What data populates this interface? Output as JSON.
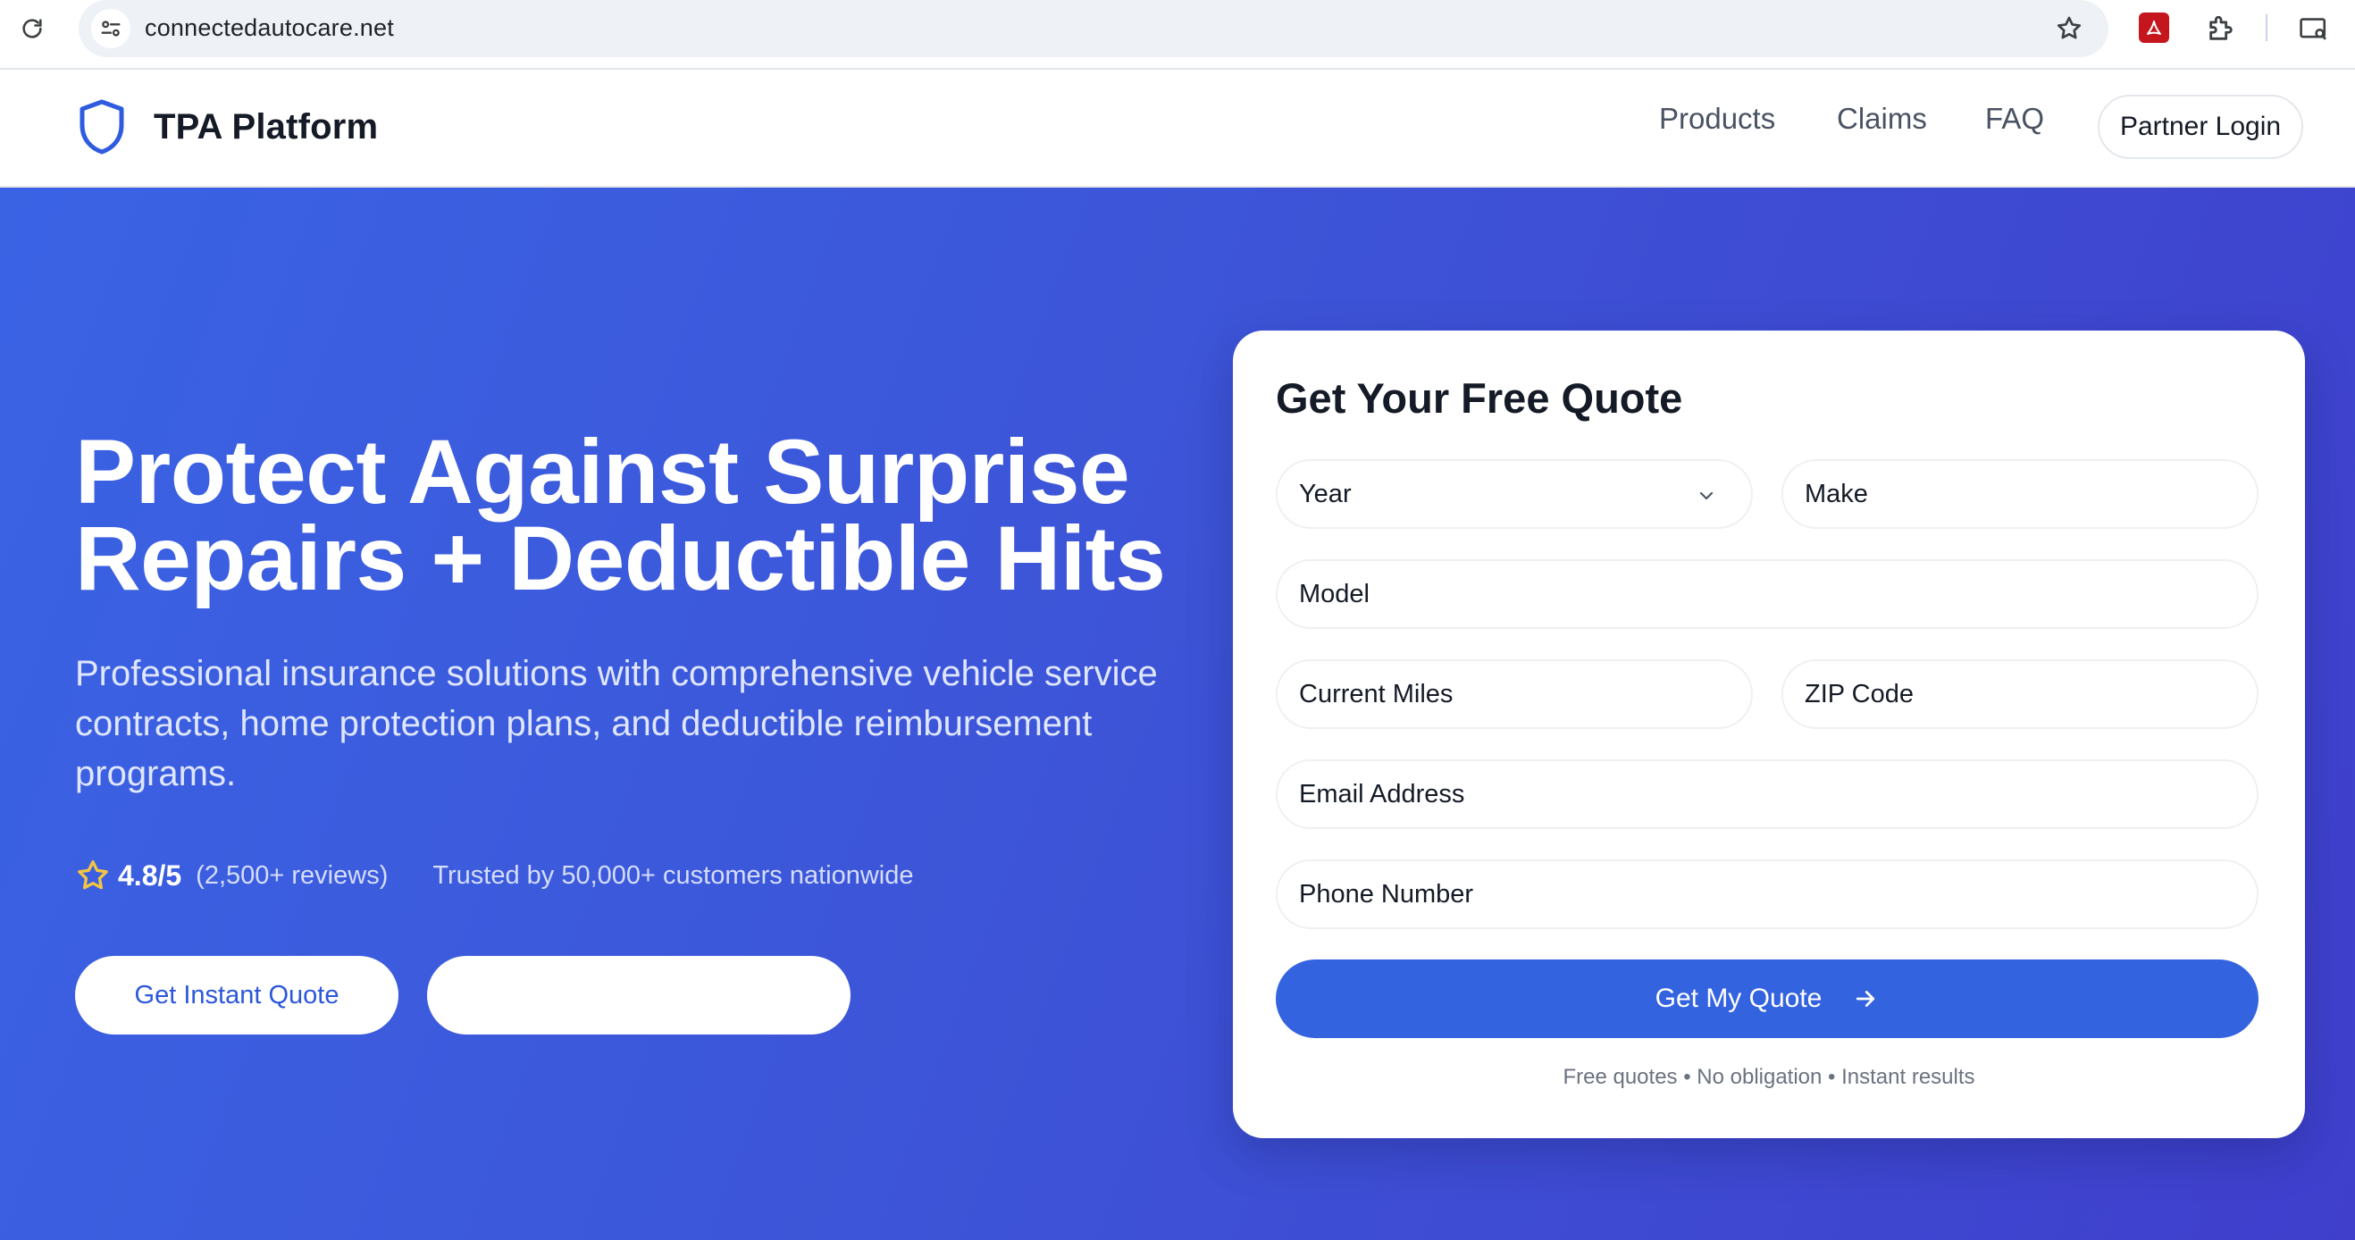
{
  "browser": {
    "url": "connectedautocare.net"
  },
  "header": {
    "brand": "TPA Platform",
    "nav": [
      "Products",
      "Claims",
      "FAQ"
    ],
    "partner_login": "Partner Login"
  },
  "hero": {
    "title_line1": "Protect Against Surprise",
    "title_line2": "Repairs + Deductible Hits",
    "subtitle": "Professional insurance solutions with comprehensive vehicle service contracts, home protection plans, and deductible reimbursement programs.",
    "rating": "4.8/5",
    "reviews": "(2,500+ reviews)",
    "trust": "Trusted by 50,000+ customers nationwide",
    "cta_primary": "Get Instant Quote",
    "cta_secondary": ""
  },
  "quote_form": {
    "title": "Get Your Free Quote",
    "year": "Year",
    "make": "Make",
    "model": "Model",
    "miles": "Current Miles",
    "zip": "ZIP Code",
    "email": "Email Address",
    "phone": "Phone Number",
    "submit": "Get My Quote",
    "footnote": "Free quotes • No obligation • Instant results"
  },
  "colors": {
    "hero_start": "#3a63e4",
    "hero_end": "#3f3fcc",
    "accent": "#3463e0",
    "rating_star": "#f5c542"
  },
  "icons": [
    "reload-icon",
    "site-info-icon",
    "bookmark-star-icon",
    "pdf-extension-icon",
    "puzzle-extension-icon",
    "media-icon",
    "shield-icon",
    "star-icon",
    "chevron-down-icon",
    "arrow-right-icon"
  ]
}
